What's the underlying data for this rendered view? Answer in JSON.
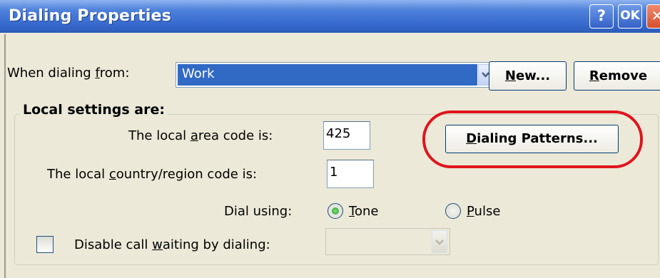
{
  "window": {
    "title": "Dialing Properties",
    "help_label": "?",
    "ok_label": "OK",
    "close_label": "✕"
  },
  "location": {
    "label_pre": "When dialing ",
    "label_key": "f",
    "label_post": "rom:",
    "selected": "Work",
    "arrow_icon": "chevron-down-icon",
    "new_key": "N",
    "new_rest": "ew...",
    "remove_key": "R",
    "remove_rest": "emove"
  },
  "local": {
    "group_title": "Local settings are:",
    "area_label_pre": "The local ",
    "area_label_key": "a",
    "area_label_post": "rea code is:",
    "area_value": "425",
    "country_label_pre": "The local ",
    "country_label_key": "c",
    "country_label_post": "ountry/region code is:",
    "country_value": "1",
    "patterns_key": "D",
    "patterns_rest": "ialing Patterns...",
    "dial_using_label": "Dial using:",
    "tone_key": "T",
    "tone_rest": "one",
    "pulse_key": "P",
    "pulse_rest": "ulse",
    "selected_dial_method": "Tone",
    "call_waiting_pre": "Disable call ",
    "call_waiting_key": "w",
    "call_waiting_post": "aiting by dialing:",
    "call_waiting_checked": false
  },
  "colors": {
    "titlebar": "#3669cc",
    "dialog_bg": "#ece9d8",
    "selection": "#316ac5",
    "highlight_ring": "#e0141d"
  }
}
